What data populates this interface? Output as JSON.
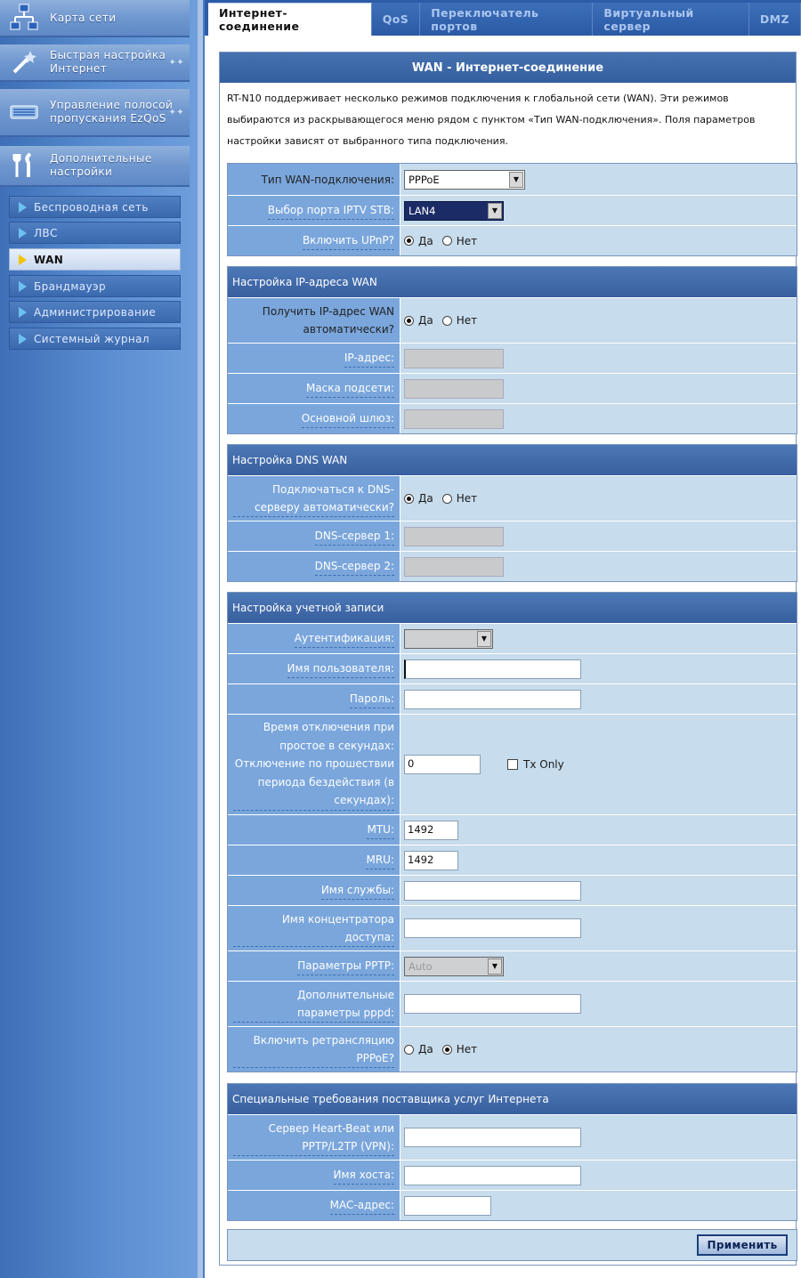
{
  "sidebar": {
    "main_menu": [
      {
        "label": "Карта сети",
        "icon": "network-map-icon"
      },
      {
        "label": "Быстрая настройка Интернет",
        "icon": "wizard-wand-icon"
      },
      {
        "label": "Управление полосой пропускания EzQoS",
        "icon": "bandwidth-icon"
      },
      {
        "label": "Дополнительные настройки",
        "icon": "tools-icon"
      }
    ],
    "submenu": [
      {
        "label": "Беспроводная сеть",
        "active": false
      },
      {
        "label": "ЛВС",
        "active": false
      },
      {
        "label": "WAN",
        "active": true
      },
      {
        "label": "Брандмауэр",
        "active": false
      },
      {
        "label": "Администрирование",
        "active": false
      },
      {
        "label": "Системный журнал",
        "active": false
      }
    ]
  },
  "tabs": [
    {
      "label": "Интернет-соединение",
      "active": true
    },
    {
      "label": "QoS"
    },
    {
      "label": "Переключатель портов"
    },
    {
      "label": "Виртуальный сервер"
    },
    {
      "label": "DMZ"
    }
  ],
  "panel": {
    "title": "WAN - Интернет-соединение",
    "desc": "RT-N10 поддерживает несколько режимов подключения к глобальной сети (WAN). Эти режимов выбираются из раскрывающегося меню рядом с пунктом «Тип WAN-подключения». Поля параметров настройки зависят от выбранного типа подключения."
  },
  "wan_type": {
    "label": "Тип WAN-подключения:",
    "value": "PPPoE",
    "iptv_label": "Выбор порта IPTV STB:",
    "iptv_value": "LAN4",
    "upnp_label": "Включить UPnP?",
    "yes": "Да",
    "no": "Нет"
  },
  "ip_section": {
    "title": "Настройка IP-адреса WAN",
    "auto_label": "Получить IP-адрес WAN автоматически?",
    "ip_label": "IP-адрес:",
    "mask_label": "Маска подсети:",
    "gw_label": "Основной шлюз:"
  },
  "dns_section": {
    "title": "Настройка DNS WAN",
    "auto_label": "Подключаться к DNS-серверу автоматически?",
    "dns1_label": "DNS-сервер 1:",
    "dns2_label": "DNS-сервер 2:"
  },
  "account_section": {
    "title": "Настройка учетной записи",
    "auth_label": "Аутентификация:",
    "user_label": "Имя пользователя:",
    "pass_label": "Пароль:",
    "idle_label": "Время отключения при простое в секундах: Отключение по прошествии периода бездействия (в секундах):",
    "idle_value": "0",
    "tx_only": "Tx Only",
    "mtu_label": "MTU:",
    "mtu_value": "1492",
    "mru_label": "MRU:",
    "mru_value": "1492",
    "service_label": "Имя службы:",
    "ac_label": "Имя концентратора доступа:",
    "pptp_label": "Параметры PPTP:",
    "pptp_value": "Auto",
    "pppd_label": "Дополнительные параметры pppd:",
    "relay_label": "Включить ретрансляцию PPPoE?"
  },
  "isp_section": {
    "title": "Специальные требования поставщика услуг Интернета",
    "heartbeat_label": "Сервер Heart-Beat или PPTP/L2TP (VPN):",
    "host_label": "Имя хоста:",
    "mac_label": "MAC-адрес:"
  },
  "apply_label": "Применить"
}
